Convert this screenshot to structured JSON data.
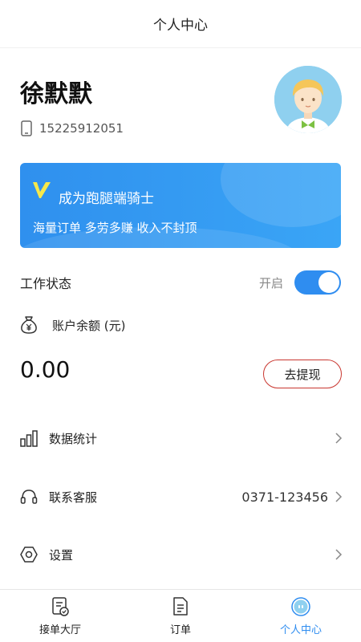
{
  "header": {
    "title": "个人中心"
  },
  "profile": {
    "name": "徐默默",
    "phone": "15225912051",
    "phone_icon": "phone-icon",
    "avatar_icon": "avatar"
  },
  "banner": {
    "title": "成为跑腿端骑士",
    "subtitle": "海量订单 多劳多赚 收入不封顶",
    "logo_icon": "v-logo-icon"
  },
  "work_status": {
    "label": "工作状态",
    "status_text": "开启",
    "enabled": true
  },
  "balance": {
    "label": "账户余额 (元)",
    "amount": "0.00",
    "withdraw_label": "去提现",
    "icon": "money-bag-icon"
  },
  "menu": {
    "items": [
      {
        "label": "数据统计",
        "icon": "bar-chart-icon",
        "value": ""
      },
      {
        "label": "联系客服",
        "icon": "headset-icon",
        "value": "0371-123456"
      },
      {
        "label": "设置",
        "icon": "settings-icon",
        "value": ""
      }
    ]
  },
  "tabbar": {
    "tabs": [
      {
        "label": "接单大厅",
        "icon": "order-hall-icon",
        "active": false
      },
      {
        "label": "订单",
        "icon": "order-list-icon",
        "active": false
      },
      {
        "label": "个人中心",
        "icon": "profile-icon",
        "active": true
      }
    ]
  },
  "colors": {
    "accent": "#2f8df0",
    "banner": "#3a9ef3",
    "withdraw_border": "#c9362f",
    "avatar_bg": "#8fd0ef"
  }
}
